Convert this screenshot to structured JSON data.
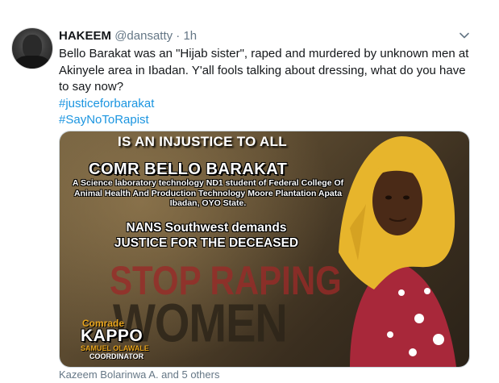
{
  "tweet": {
    "display_name": "HAKEEM",
    "handle": "@dansatty",
    "separator": "·",
    "timestamp": "1h",
    "text": "Bello Barakat was an \"Hijab sister\", raped and murdered by unknown men at Akinyele area in Ibadan. Y'all fools talking about dressing, what do you have to say now?",
    "hashtags": [
      "#justiceforbarakat",
      "#SayNoToRapist"
    ]
  },
  "media": {
    "top_line": "IS AN INJUSTICE TO ALL",
    "name_line": "COMR BELLO BARAKAT",
    "description": "A Science laboratory technology ND1 student of Federal College Of Animal Health And Production Technology Moore Plantation Apata Ibadan, OYO State.",
    "demand_line1": "NANS Southwest demands",
    "demand_line2": "JUSTICE FOR THE DECEASED",
    "stop_text": "STOP RAPING",
    "women_text": "WOMEN",
    "signature_title": "Comrade",
    "signature_name": "KAPPO",
    "signature_full": "SAMUEL OLAWALE",
    "signature_role": "COORDINATOR"
  },
  "footer": {
    "tagged": "Kazeem Bolarinwa A. and 5 others"
  },
  "icons": {
    "menu": "chevron-down-icon"
  },
  "colors": {
    "link": "#1b95e0",
    "muted": "#657786",
    "text": "#14171a",
    "hijab": "#e7b52c",
    "dress": "#a8283a"
  }
}
